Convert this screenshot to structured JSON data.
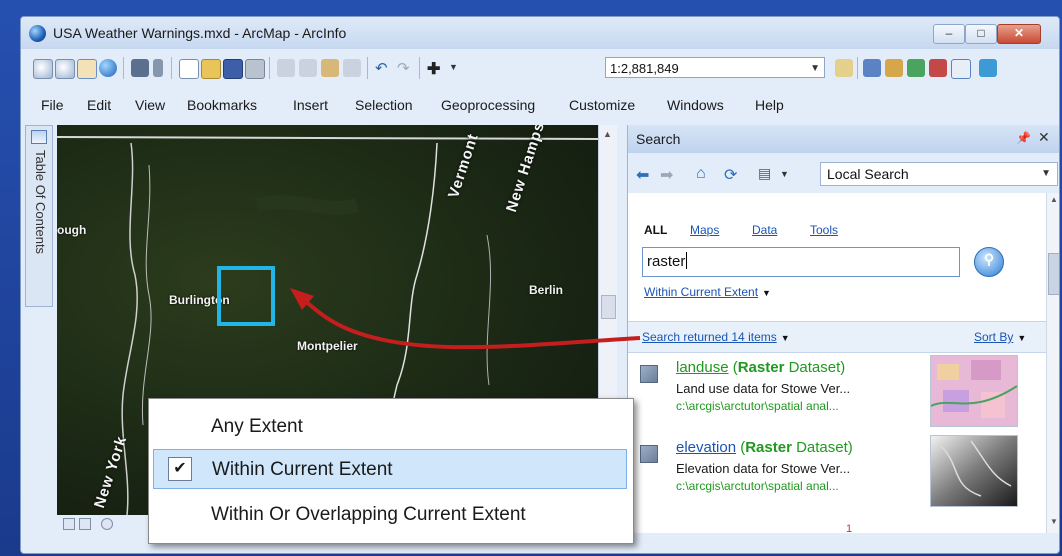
{
  "window": {
    "title": "USA Weather Warnings.mxd - ArcMap - ArcInfo"
  },
  "toolbar": {
    "scale_value": "1:2,881,849"
  },
  "menu": [
    "File",
    "Edit",
    "View",
    "Bookmarks",
    "Insert",
    "Selection",
    "Geoprocessing",
    "Customize",
    "Windows",
    "Help"
  ],
  "toc": {
    "label": "Table Of Contents"
  },
  "map": {
    "places": [
      "ough",
      "Burlington",
      "Montpelier",
      "Berlin"
    ],
    "states": [
      "Vermont",
      "New Hamps",
      "New York"
    ]
  },
  "search_pane": {
    "title": "Search",
    "pin_glyph": "📌",
    "close_glyph": "✕",
    "scope_value": "Local Search",
    "filters": {
      "all": "ALL",
      "maps": "Maps",
      "data": "Data",
      "tools": "Tools"
    },
    "query": "raster",
    "extent_label": "Within Current Extent",
    "results_label": "Search returned 14 items",
    "sort_label": "Sort By",
    "page_number": "1",
    "results": [
      {
        "name": "landuse",
        "type_strong": "Raster",
        "type_rest": " Dataset)",
        "description": "Land use data for Stowe Ver...",
        "path": "c:\\arcgis\\arctutor\\spatial anal..."
      },
      {
        "name": "elevation",
        "type_strong": "Raster",
        "type_rest": " Dataset)",
        "description": "Elevation data for Stowe Ver...",
        "path": "c:\\arcgis\\arctutor\\spatial anal..."
      }
    ]
  },
  "extent_dropdown": {
    "options": [
      {
        "label": "Any Extent",
        "checked": false
      },
      {
        "label": "Within Current Extent",
        "checked": true
      },
      {
        "label": "Within Or Overlapping Current Extent",
        "checked": false
      }
    ],
    "check_glyph": "✔"
  },
  "colors": {
    "highlight_box": "#23b5e6",
    "arrow": "#c41e1e",
    "link": "#1a55b5",
    "result_green": "#1f9a1f"
  }
}
